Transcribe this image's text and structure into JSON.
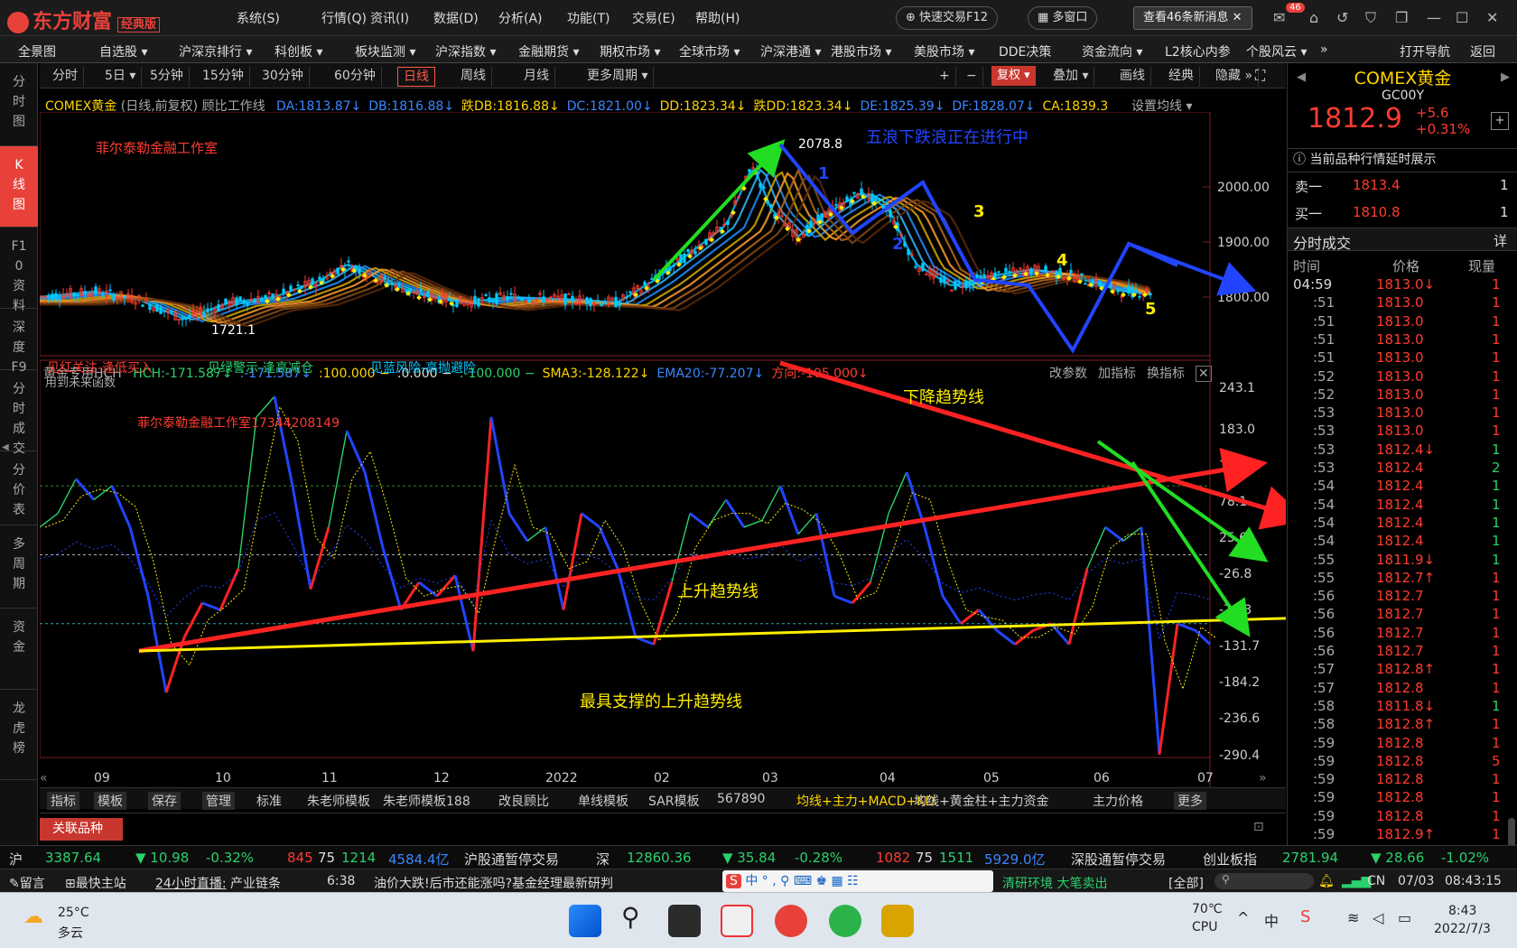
{
  "app": {
    "name": "东方财富",
    "edition": "经典版"
  },
  "menu": [
    "系统(S)",
    "行情(Q)",
    "资讯(I)",
    "数据(D)",
    "分析(A)",
    "功能(T)",
    "交易(E)",
    "帮助(H)"
  ],
  "title_buttons": {
    "quick_trade": "快速交易F12",
    "multi_window": "多窗口",
    "messages": "查看46条新消息",
    "badge": "46"
  },
  "nav": [
    "全景图",
    "自选股 ▾",
    "沪深京排行 ▾",
    "科创板 ▾",
    "板块监测 ▾",
    "沪深指数 ▾",
    "金融期货 ▾",
    "期权市场 ▾",
    "全球市场 ▾",
    "沪深港通 ▾",
    "港股市场 ▾",
    "美股市场 ▾",
    "DDE决策",
    "资金流向 ▾",
    "L2核心内参",
    "个股风云 ▾",
    "»",
    "打开导航",
    "返回"
  ],
  "left_sidebar": [
    "分时图",
    "K线图",
    "F10资料",
    "深度F9",
    "分时成交",
    "分价表",
    "多周期",
    "资金",
    "龙虎榜"
  ],
  "period_tabs": [
    "分时",
    "5日 ▾",
    "5分钟",
    "15分钟",
    "30分钟",
    "60分钟",
    "日线",
    "周线",
    "月线",
    "更多周期 ▾"
  ],
  "active_period": "日线",
  "chart_tools": [
    "+",
    "−",
    "复权 ▾",
    "叠加 ▾",
    "画线",
    "经典",
    "隐藏 »"
  ],
  "kline_header": {
    "name": "COMEX黄金",
    "mode": "(日线,前复权)",
    "indicator": "顾比工作线",
    "items": [
      {
        "t": "DA:1813.87↓",
        "c": "#3b86ff"
      },
      {
        "t": "DB:1816.88↓",
        "c": "#3b86ff"
      },
      {
        "t": "跌DB:1816.88↓",
        "c": "#ffd400"
      },
      {
        "t": "DC:1821.00↓",
        "c": "#3b86ff"
      },
      {
        "t": "DD:1823.34↓",
        "c": "#ffd400"
      },
      {
        "t": "跌DD:1823.34↓",
        "c": "#ffd400"
      },
      {
        "t": "DE:1825.39↓",
        "c": "#3b86ff"
      },
      {
        "t": "DF:1828.07↓",
        "c": "#3b86ff"
      },
      {
        "t": "CA:1839.3",
        "c": "#ffd400"
      }
    ],
    "settings": "设置均线 ▾"
  },
  "kline_annotations": {
    "studio": "菲尔泰勒金融工作室",
    "wave_text": "五浪下跌浪正在进行中",
    "high": "2078.8",
    "low": "1721.1",
    "wave_labels": [
      "1",
      "2",
      "3",
      "4",
      "5"
    ]
  },
  "kline_axis": [
    "2000.00",
    "1900.00",
    "1800.00"
  ],
  "ind_header": {
    "name": "黄金专用HCH",
    "items": [
      {
        "t": "HCH:-171.587↓",
        "c": "#2bd16c"
      },
      {
        "t": ":-171.587↓",
        "c": "#3b86ff"
      },
      {
        "t": ":100.000 −",
        "c": "#ffd400"
      },
      {
        "t": ":0.000 −",
        "c": "#dddddd"
      },
      {
        "t": ":-100.000 −",
        "c": "#2bd16c"
      },
      {
        "t": "SMA3:-128.122↓",
        "c": "#ffd400"
      },
      {
        "t": "EMA20:-77.207↓",
        "c": "#3b86ff"
      },
      {
        "t": "方向:-105.000↓",
        "c": "#ff3b30"
      }
    ],
    "tools": [
      "改参数",
      "加指标",
      "换指标",
      "✕"
    ]
  },
  "ind_annotations": {
    "red_note": "见红关注-逢低买入",
    "green_note": "见绿警示-逢高减仓",
    "blue_note": "见蓝风险-高抛避险",
    "future_fn": "用到未来函数",
    "studio_phone": "菲尔泰勒金融工作室17344208149",
    "down_trend": "下降趋势线",
    "up_trend": "上升趋势线",
    "support": "最具支撑的上升趋势线"
  },
  "ind_axis": [
    "243.1",
    "183.0",
    "130.5",
    "78.1",
    "25.6",
    "-26.8",
    "-79.3",
    "-131.7",
    "-184.2",
    "-236.6",
    "-290.4"
  ],
  "x_axis": [
    "09",
    "10",
    "11",
    "12",
    "2022",
    "02",
    "03",
    "04",
    "05",
    "06",
    "07"
  ],
  "bottom_tabs": [
    "指标",
    "模板",
    "保存",
    "管理",
    "标准",
    "朱老师模板",
    "朱老师模板188",
    "改良顾比",
    "单线模板",
    "SAR模板",
    "567890",
    "均线+主力+MACD+KD",
    "均线+黄金柱+主力资金",
    "主力价格",
    "更多"
  ],
  "active_template": "均线+主力+MACD+KD",
  "related": "关联品种",
  "quote": {
    "name": "COMEX黄金",
    "code": "GC00Y",
    "price": "1812.9",
    "change": "+5.6",
    "pct": "+0.31%",
    "notice": "当前品种行情延时展示",
    "sell_label": "卖一",
    "sell": "1813.4",
    "sell_vol": "1",
    "buy_label": "买一",
    "buy": "1810.8",
    "buy_vol": "1",
    "trades_title": "分时成交",
    "detail": "详",
    "cols": [
      "时间",
      "价格",
      "现量"
    ]
  },
  "trades": [
    {
      "t": "04:59",
      "p": "1813.0↓",
      "v": "1",
      "c": "#ff3b30",
      "vc": "#ff3b30"
    },
    {
      "t": ":51",
      "p": "1813.0",
      "v": "1",
      "c": "#ff3b30",
      "vc": "#ff3b30"
    },
    {
      "t": ":51",
      "p": "1813.0",
      "v": "1",
      "c": "#ff3b30",
      "vc": "#ff3b30"
    },
    {
      "t": ":51",
      "p": "1813.0",
      "v": "1",
      "c": "#ff3b30",
      "vc": "#ff3b30"
    },
    {
      "t": ":51",
      "p": "1813.0",
      "v": "1",
      "c": "#ff3b30",
      "vc": "#ff3b30"
    },
    {
      "t": ":52",
      "p": "1813.0",
      "v": "1",
      "c": "#ff3b30",
      "vc": "#ff3b30"
    },
    {
      "t": ":52",
      "p": "1813.0",
      "v": "1",
      "c": "#ff3b30",
      "vc": "#ff3b30"
    },
    {
      "t": ":53",
      "p": "1813.0",
      "v": "1",
      "c": "#ff3b30",
      "vc": "#ff3b30"
    },
    {
      "t": ":53",
      "p": "1813.0",
      "v": "1",
      "c": "#ff3b30",
      "vc": "#ff3b30"
    },
    {
      "t": ":53",
      "p": "1812.4↓",
      "v": "1",
      "c": "#ff3b30",
      "vc": "#2bd16c"
    },
    {
      "t": ":53",
      "p": "1812.4",
      "v": "2",
      "c": "#ff3b30",
      "vc": "#2bd16c"
    },
    {
      "t": ":54",
      "p": "1812.4",
      "v": "1",
      "c": "#ff3b30",
      "vc": "#2bd16c"
    },
    {
      "t": ":54",
      "p": "1812.4",
      "v": "1",
      "c": "#ff3b30",
      "vc": "#2bd16c"
    },
    {
      "t": ":54",
      "p": "1812.4",
      "v": "1",
      "c": "#ff3b30",
      "vc": "#2bd16c"
    },
    {
      "t": ":54",
      "p": "1812.4",
      "v": "1",
      "c": "#ff3b30",
      "vc": "#2bd16c"
    },
    {
      "t": ":55",
      "p": "1811.9↓",
      "v": "1",
      "c": "#ff3b30",
      "vc": "#2bd16c"
    },
    {
      "t": ":55",
      "p": "1812.7↑",
      "v": "1",
      "c": "#ff3b30",
      "vc": "#ff3b30"
    },
    {
      "t": ":56",
      "p": "1812.7",
      "v": "1",
      "c": "#ff3b30",
      "vc": "#ff3b30"
    },
    {
      "t": ":56",
      "p": "1812.7",
      "v": "1",
      "c": "#ff3b30",
      "vc": "#ff3b30"
    },
    {
      "t": ":56",
      "p": "1812.7",
      "v": "1",
      "c": "#ff3b30",
      "vc": "#ff3b30"
    },
    {
      "t": ":56",
      "p": "1812.7",
      "v": "1",
      "c": "#ff3b30",
      "vc": "#ff3b30"
    },
    {
      "t": ":57",
      "p": "1812.8↑",
      "v": "1",
      "c": "#ff3b30",
      "vc": "#ff3b30"
    },
    {
      "t": ":57",
      "p": "1812.8",
      "v": "1",
      "c": "#ff3b30",
      "vc": "#ff3b30"
    },
    {
      "t": ":58",
      "p": "1811.8↓",
      "v": "1",
      "c": "#ff3b30",
      "vc": "#2bd16c"
    },
    {
      "t": ":58",
      "p": "1812.8↑",
      "v": "1",
      "c": "#ff3b30",
      "vc": "#ff3b30"
    },
    {
      "t": ":59",
      "p": "1812.8",
      "v": "1",
      "c": "#ff3b30",
      "vc": "#ff3b30"
    },
    {
      "t": ":59",
      "p": "1812.8",
      "v": "5",
      "c": "#ff3b30",
      "vc": "#ff3b30"
    },
    {
      "t": ":59",
      "p": "1812.8",
      "v": "1",
      "c": "#ff3b30",
      "vc": "#ff3b30"
    },
    {
      "t": ":59",
      "p": "1812.8",
      "v": "1",
      "c": "#ff3b30",
      "vc": "#ff3b30"
    },
    {
      "t": ":59",
      "p": "1812.8",
      "v": "1",
      "c": "#ff3b30",
      "vc": "#ff3b30"
    },
    {
      "t": ":59",
      "p": "1812.9↑",
      "v": "1",
      "c": "#ff3b30",
      "vc": "#ff3b30"
    }
  ],
  "ticker": [
    {
      "t": "沪",
      "c": "#dddddd"
    },
    {
      "t": "3387.64",
      "c": "#2bd16c"
    },
    {
      "t": "▼ 10.98",
      "c": "#2bd16c"
    },
    {
      "t": "-0.32%",
      "c": "#2bd16c"
    },
    {
      "t": "845",
      "c": "#ff3b30"
    },
    {
      "t": "75",
      "c": "#dddddd"
    },
    {
      "t": "1214",
      "c": "#2bd16c"
    },
    {
      "t": "4584.4亿",
      "c": "#3b86ff"
    },
    {
      "t": "沪股通暂停交易",
      "c": "#dddddd"
    },
    {
      "t": "深",
      "c": "#dddddd"
    },
    {
      "t": "12860.36",
      "c": "#2bd16c"
    },
    {
      "t": "▼ 35.84",
      "c": "#2bd16c"
    },
    {
      "t": "-0.28%",
      "c": "#2bd16c"
    },
    {
      "t": "1082",
      "c": "#ff3b30"
    },
    {
      "t": "75",
      "c": "#dddddd"
    },
    {
      "t": "1511",
      "c": "#2bd16c"
    },
    {
      "t": "5929.0亿",
      "c": "#3b86ff"
    },
    {
      "t": "深股通暂停交易",
      "c": "#dddddd"
    },
    {
      "t": "创业板指",
      "c": "#dddddd"
    },
    {
      "t": "2781.94",
      "c": "#2bd16c"
    },
    {
      "t": "▼ 28.66",
      "c": "#2bd16c"
    },
    {
      "t": "-1.02%",
      "c": "#2bd16c"
    }
  ],
  "status": {
    "msg": "留言",
    "main": "最快主站",
    "live": "24小时直播:",
    "live_topic": "产业链条",
    "time": "6:38",
    "headline": "油价大跌!后市还能涨吗?基金经理最新研判",
    "env": "清研环境 大笔卖出",
    "all": "[全部]",
    "region": "CN",
    "date": "07/03",
    "clock": "08:43:15"
  },
  "taskbar": {
    "weather_temp": "25°C",
    "weather_desc": "多云",
    "cpu_temp": "70℃",
    "cpu": "CPU",
    "ime": "中",
    "time": "8:43",
    "date": "2022/7/3"
  }
}
